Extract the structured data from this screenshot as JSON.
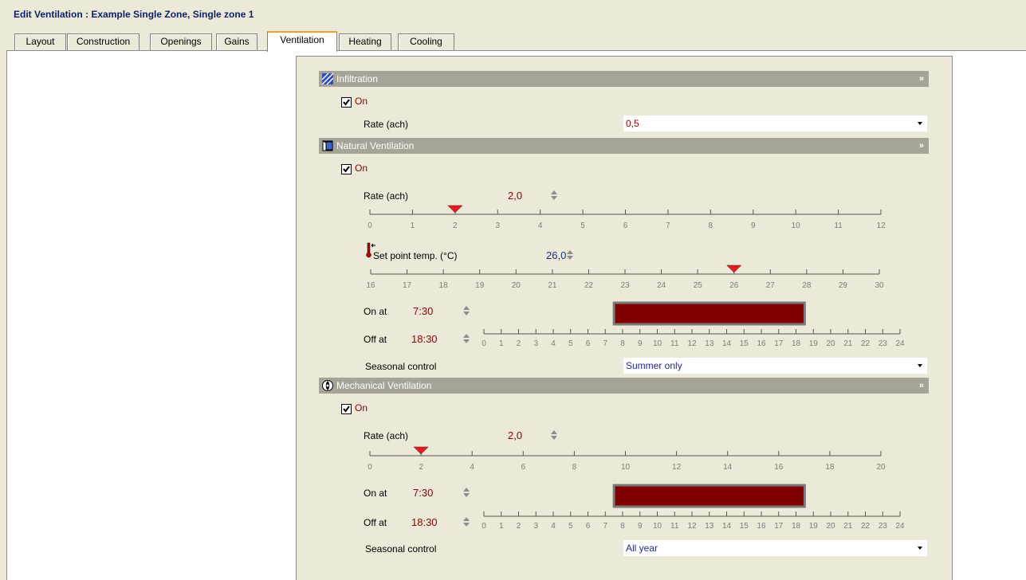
{
  "window_title": "Edit Ventilation : Example Single Zone, Single zone 1",
  "tabs": [
    "Layout",
    "Construction",
    "Openings",
    "Gains",
    "Ventilation",
    "Heating",
    "Cooling"
  ],
  "active_tab": "Ventilation",
  "infiltration": {
    "header": "Infiltration",
    "enabled": true,
    "on_label": "On",
    "rate_label": "Rate (ach)",
    "rate_value": "0,5"
  },
  "natural": {
    "header": "Natural Ventilation",
    "enabled": true,
    "on_label": "On",
    "rate_label": "Rate (ach)",
    "rate_value": "2,0",
    "rate_scale_ticks": [
      "0",
      "1",
      "2",
      "3",
      "4",
      "5",
      "6",
      "7",
      "8",
      "9",
      "10",
      "11",
      "12"
    ],
    "rate_numeric": 2.0,
    "setpoint_label": "Set point temp. (°C)",
    "setpoint_value": "26,0",
    "setpoint_scale_ticks": [
      "16",
      "17",
      "18",
      "19",
      "20",
      "21",
      "22",
      "23",
      "24",
      "25",
      "26",
      "27",
      "28",
      "29",
      "30"
    ],
    "setpoint_numeric": 26.0,
    "on_at_label": "On at",
    "on_at_value": "7:30",
    "off_at_label": "Off at",
    "off_at_value": "18:30",
    "schedule_start_hour": 7.5,
    "schedule_end_hour": 18.5,
    "seasonal_label": "Seasonal control",
    "seasonal_value": "Summer only"
  },
  "mechanical": {
    "header": "Mechanical Ventilation",
    "enabled": true,
    "on_label": "On",
    "rate_label": "Rate (ach)",
    "rate_value": "2,0",
    "rate_scale_ticks": [
      "0",
      "2",
      "4",
      "6",
      "8",
      "10",
      "12",
      "14",
      "16",
      "18",
      "20"
    ],
    "rate_numeric": 2.0,
    "on_at_label": "On at",
    "on_at_value": "7:30",
    "off_at_label": "Off at",
    "off_at_value": "18:30",
    "schedule_start_hour": 7.5,
    "schedule_end_hour": 18.5,
    "seasonal_label": "Seasonal control",
    "seasonal_value": "All year"
  },
  "hour_ticks": [
    "0",
    "1",
    "2",
    "3",
    "4",
    "5",
    "6",
    "7",
    "8",
    "9",
    "10",
    "11",
    "12",
    "13",
    "14",
    "15",
    "16",
    "17",
    "18",
    "19",
    "20",
    "21",
    "22",
    "23",
    "24"
  ],
  "colors": {
    "header_bg": "#a5a497",
    "schedule_fill": "#800000",
    "marker": "#e02020",
    "value_red": "#8b0000",
    "value_blue": "#1f2a8a",
    "active_tab_accent": "#f29f36"
  }
}
